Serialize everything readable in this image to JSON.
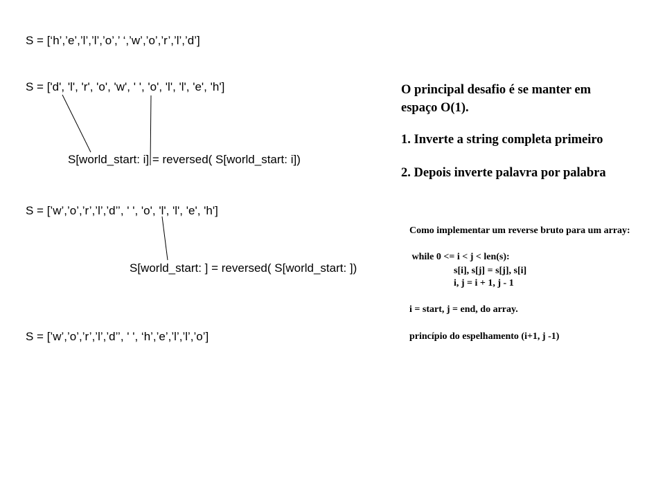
{
  "left": {
    "array_original": "S = [‘h’,’e’,’l’,’l’,’o’,’ ‘,’w’,’o’,’r’,’l’,’d’]",
    "array_reversed": "S = ['d', 'l', 'r', 'o', 'w', ' ', 'o', 'l', 'l', 'e', 'h']",
    "formula_1": "S[world_start: i] = reversed( S[world_start: i])",
    "array_word1_reversed": "S = [’w’,’o’,’r’,’l’,’d’’, ' ', 'o', 'l', 'l', 'e', 'h']",
    "formula_2": "S[world_start: ] = reversed( S[world_start: ])",
    "array_final": "S = [’w’,’o’,’r’,’l’,’d’’, ' ', ‘h’,’e’,’l’,’l’,’o’]"
  },
  "right": {
    "heading_line1": "O principal desafio é se manter em",
    "heading_line2": "espaço O(1).",
    "step1": "1. Inverte a string completa primeiro",
    "step2": "2. Depois inverte palavra por palabra",
    "code_title": "Como implementar um reverse bruto para um array:",
    "code_line1": " while 0 <= i < j < len(s):",
    "code_line2": "s[i], s[j] = s[j], s[i]",
    "code_line3": "i, j = i + 1, j - 1",
    "code_note1": "i = start, j = end, do array.",
    "code_note2": "princípio do espelhamento (i+1, j -1)"
  }
}
